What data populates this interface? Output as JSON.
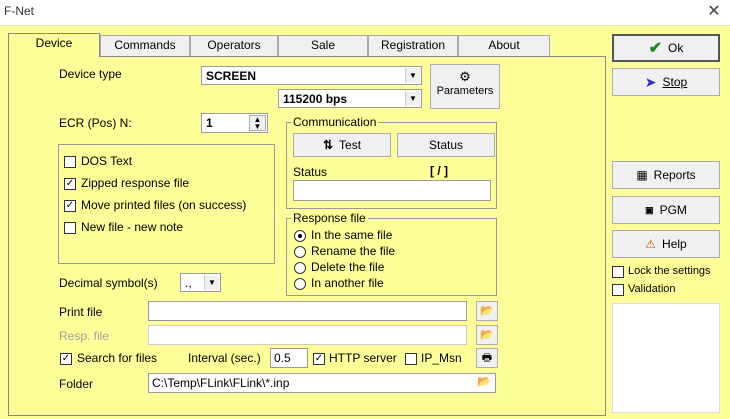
{
  "window": {
    "title": "F-Net"
  },
  "tabs": [
    "Device",
    "Commands",
    "Operators",
    "Sale",
    "Registration",
    "About"
  ],
  "device": {
    "device_type_label": "Device type",
    "device_type_value": "SCREEN",
    "baud_value": "115200 bps",
    "parameters_label": "Parameters",
    "ecr_label": "ECR (Pos) N:",
    "ecr_value": "1",
    "options": [
      {
        "label": "DOS Text",
        "checked": false
      },
      {
        "label": "Zipped response file",
        "checked": true
      },
      {
        "label": "Move printed files (on success)",
        "checked": true
      },
      {
        "label": "New file - new note",
        "checked": false
      }
    ],
    "decimal_label": "Decimal symbol(s)",
    "decimal_value": ".,",
    "print_file_label": "Print file",
    "resp_file_label": "Resp. file",
    "search_label": "Search for files",
    "search_checked": true,
    "interval_label": "Interval (sec.)",
    "interval_value": "0.5",
    "http_label": "HTTP server",
    "http_checked": true,
    "ipmsn_label": "IP_Msn",
    "ipmsn_checked": false,
    "folder_label": "Folder",
    "folder_value": "C:\\Temp\\FLink\\FLink\\*.inp"
  },
  "communication": {
    "title": "Communication",
    "test_label": "Test",
    "status_button_label": "Status",
    "status_label": "Status",
    "status_indicator": "[ / ]"
  },
  "response_file": {
    "title": "Response file",
    "options": [
      {
        "label": "In the same file",
        "selected": true
      },
      {
        "label": "Rename the file",
        "selected": false
      },
      {
        "label": "Delete the file",
        "selected": false
      },
      {
        "label": "In another file",
        "selected": false
      }
    ]
  },
  "side": {
    "ok_label": "Ok",
    "stop_label": "Stop",
    "reports_label": "Reports",
    "pgm_label": "PGM",
    "help_label": "Help",
    "lock_label": "Lock the settings",
    "validation_label": "Validation"
  },
  "colors": {
    "background": "#ffff99",
    "ok_check": "#1a8a1a",
    "stop_arrow": "#3030c0"
  }
}
